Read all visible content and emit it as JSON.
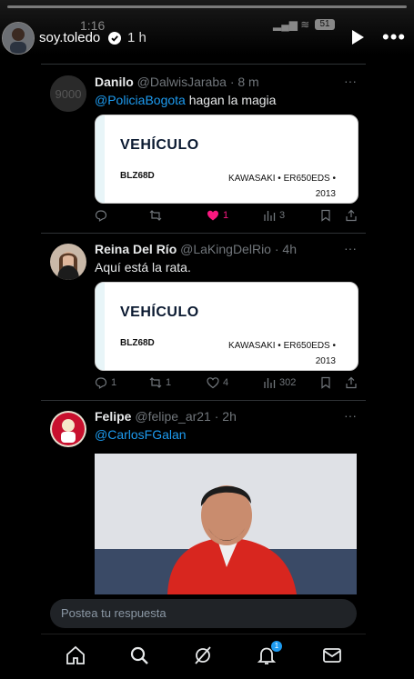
{
  "story": {
    "username": "soy.toledo",
    "time": "1 h",
    "status_time": "1:16",
    "battery": "51"
  },
  "tweets": [
    {
      "name": "Danilo",
      "handle": "@DalwisJaraba",
      "time": "· 8 m",
      "mention": "@PoliciaBogota",
      "text": " hagan la magia",
      "card": {
        "title": "VEHÍCULO",
        "plate": "BLZ68D",
        "model": "KAWASAKI • ER650EDS • 2013"
      },
      "replies": "",
      "retweets": "",
      "likes": "1",
      "views": "3",
      "avatar_text": "9000"
    },
    {
      "name": "Reina Del Río",
      "handle": "@LaKingDelRio",
      "time": "· 4h",
      "text": "Aquí está la rata.",
      "card": {
        "title": "VEHÍCULO",
        "plate": "BLZ68D",
        "model": "KAWASAKI • ER650EDS • 2013"
      },
      "replies": "1",
      "retweets": "1",
      "likes": "4",
      "views": "302"
    },
    {
      "name": "Felipe",
      "handle": "@felipe_ar21",
      "time": "· 2h",
      "mention": "@CarlosFGalan"
    }
  ],
  "reply": {
    "placeholder": "Postea tu respuesta"
  },
  "nav": {
    "notifications_count": "1"
  },
  "colors": {
    "accent": "#1d9bf0",
    "like": "#f91880"
  }
}
